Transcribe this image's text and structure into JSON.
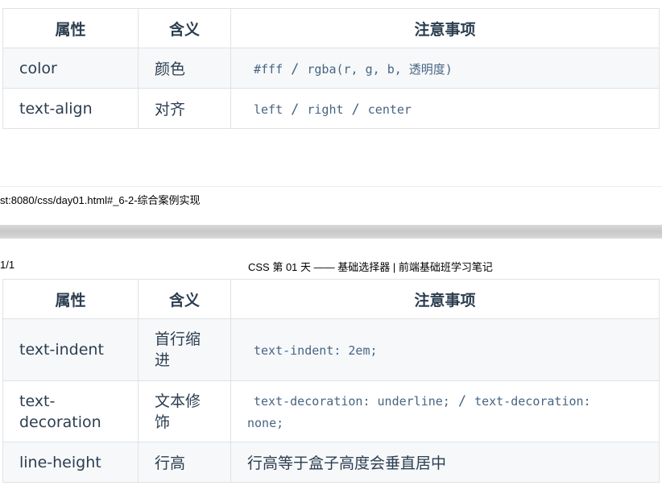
{
  "table1": {
    "headers": [
      "属性",
      "含义",
      "注意事项"
    ],
    "rows": [
      {
        "prop": "color",
        "meaning": "颜色",
        "note_parts": [
          "#fff",
          "/",
          "rgba(r, g, b, 透明度)"
        ]
      },
      {
        "prop": "text-align",
        "meaning": "对齐",
        "note_parts": [
          "left",
          "/",
          "right",
          "/",
          "center"
        ]
      }
    ]
  },
  "footer": {
    "url": "st:8080/css/day01.html#_6-2-综合案例实现"
  },
  "header": {
    "page": "1/1",
    "title": "CSS 第 01 天 —— 基础选择器 | 前端基础班学习笔记"
  },
  "table2": {
    "headers": [
      "属性",
      "含义",
      "注意事项"
    ],
    "rows": [
      {
        "prop": "text-indent",
        "meaning": "首行缩进",
        "note": "text-indent: 2em;"
      },
      {
        "prop": "text-decoration",
        "meaning": "文本修饰",
        "note_a": "text-decoration: underline;",
        "sep": "/",
        "note_b": "text-decoration: none;"
      },
      {
        "prop": "line-height",
        "meaning": "行高",
        "note": "行高等于盒子高度会垂直居中"
      }
    ]
  }
}
